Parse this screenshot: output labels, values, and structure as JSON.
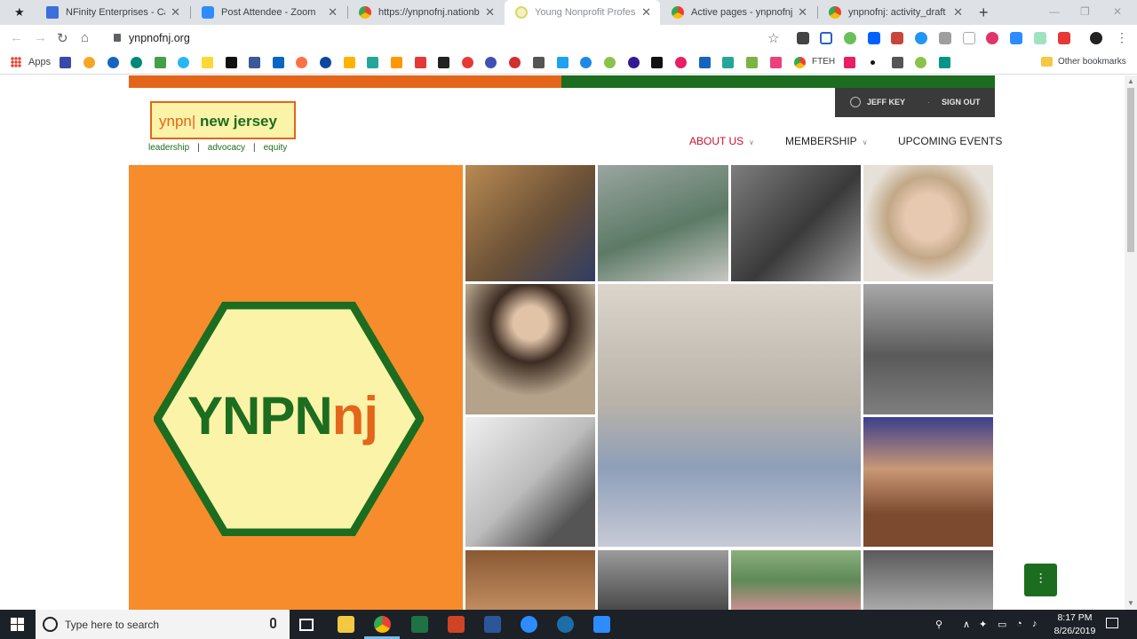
{
  "browser": {
    "tabs": [
      {
        "title": "NFinity Enterprises - Calend",
        "favicon_color": "#3b6fd9"
      },
      {
        "title": "Post Attendee - Zoom",
        "favicon_color": "#2d8cff"
      },
      {
        "title": "https://ynpnofnj.nationbuil",
        "favicon_color": "#e94235"
      },
      {
        "title": "Young Nonprofit Profession",
        "favicon_color": "#d8d86a"
      },
      {
        "title": "Active pages - ynpnofnj",
        "favicon_color": "#e94235"
      },
      {
        "title": "ynpnofnj: activity_draft",
        "favicon_color": "#e94235"
      }
    ],
    "url": "ynpnofnj.org",
    "bookmarks": {
      "apps_label": "Apps",
      "fteh_label": "FTEH",
      "other_label": "Other bookmarks"
    }
  },
  "site": {
    "logo": {
      "prefix": "ynpn|",
      "name": " new jersey"
    },
    "tagline": {
      "one": "leadership",
      "sep": "|",
      "two": "advocacy",
      "three": "equity"
    },
    "user": {
      "name": "JEFF KEY",
      "signout": "SIGN OUT"
    },
    "nav": [
      {
        "label": "ABOUT US",
        "has_caret": true,
        "active": true
      },
      {
        "label": "MEMBERSHIP",
        "has_caret": true,
        "active": false
      },
      {
        "label": "UPCOMING EVENTS",
        "has_caret": false,
        "active": false
      }
    ],
    "hero": {
      "text_main": "YNPN",
      "text_accent": "nj"
    },
    "colors": {
      "orange": "#f78c2c",
      "dark_orange": "#e3661a",
      "green": "#1c6d1f",
      "cream": "#fbf3a8"
    }
  },
  "taskbar": {
    "search_placeholder": "Type here to search",
    "time": "8:17 PM",
    "date": "8/26/2019"
  }
}
